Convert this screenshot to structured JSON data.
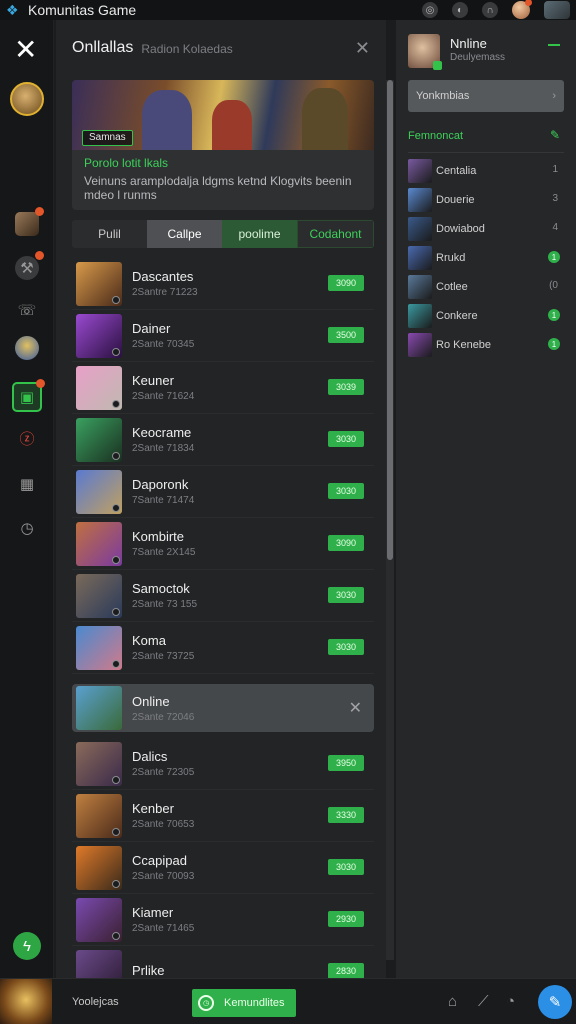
{
  "app": {
    "title": "Komunitas Game"
  },
  "rail": {
    "active_badge": ""
  },
  "panel": {
    "title": "Onllallas",
    "subtitle": "Radion Kolaedas",
    "hero": {
      "tag": "Samnas",
      "heading": "Porolo lotit lkals",
      "description": "Veinuns aramplodalja ldgms ketnd Klogvits beenin mdeo l runms"
    },
    "tabs": [
      "Pulil",
      "Callpe",
      "poolime",
      "Codahont"
    ]
  },
  "games": [
    {
      "name": "Dascantes",
      "meta": "2Santre 71223",
      "btn": "3090",
      "colors": [
        "#d89a4a",
        "#4a2a1a"
      ]
    },
    {
      "name": "Dainer",
      "meta": "2Sante 70345",
      "btn": "3500",
      "colors": [
        "#9a4ad0",
        "#2a1040"
      ]
    },
    {
      "name": "Keuner",
      "meta": "2Sante 71624",
      "btn": "3039",
      "colors": [
        "#e8a0c8",
        "#c0b8b0"
      ]
    },
    {
      "name": "Keocrame",
      "meta": "2Sante 71834",
      "btn": "3030",
      "colors": [
        "#3aa060",
        "#1a3020"
      ]
    },
    {
      "name": "Daporonk",
      "meta": "7Sante 71474",
      "btn": "3030",
      "colors": [
        "#5a7ad0",
        "#c0a060"
      ]
    },
    {
      "name": "Kombirte",
      "meta": "7Sante 2X145",
      "btn": "3090",
      "colors": [
        "#c07040",
        "#7a3aa0"
      ]
    },
    {
      "name": "Samoctok",
      "meta": "2Sante 73 155",
      "btn": "3030",
      "colors": [
        "#7a6a5a",
        "#2a3a5a"
      ]
    },
    {
      "name": "Koma",
      "meta": "2Sante 73725",
      "btn": "3030",
      "colors": [
        "#4a8ad0",
        "#d07a8a"
      ]
    }
  ],
  "special_row": {
    "name": "Online",
    "meta": "2Sante 72046"
  },
  "games_more": [
    {
      "name": "Dalics",
      "meta": "2Sante 72305",
      "btn": "3950",
      "colors": [
        "#8a6a5a",
        "#3a2a4a"
      ]
    },
    {
      "name": "Kenber",
      "meta": "2Sante 70653",
      "btn": "3330",
      "colors": [
        "#c08040",
        "#4a2a1a"
      ]
    },
    {
      "name": "Ccapipad",
      "meta": "2Sante 70093",
      "btn": "3030",
      "colors": [
        "#e07a2a",
        "#3a2a1a"
      ]
    },
    {
      "name": "Kiamer",
      "meta": "2Sante 71465",
      "btn": "2930",
      "colors": [
        "#7a4ab0",
        "#3a2030"
      ]
    },
    {
      "name": "Prlike",
      "meta": "",
      "btn": "2830",
      "colors": [
        "#6a4a8a",
        "#2a1a30"
      ]
    }
  ],
  "right": {
    "name": "Nnline",
    "status": "Deulyemass",
    "search": "Yonkmbias",
    "section": "Femnoncat",
    "friends": [
      {
        "name": "Centalia",
        "count": "1",
        "dot": false,
        "color": "#7a5aa0"
      },
      {
        "name": "Douerie",
        "count": "3",
        "dot": false,
        "color": "#5a8ad0"
      },
      {
        "name": "Dowiabod",
        "count": "4",
        "dot": false,
        "color": "#3a5a8a"
      },
      {
        "name": "Rrukd",
        "count": "1",
        "dot": true,
        "color": "#4a6ab0"
      },
      {
        "name": "Cotlee",
        "count": "(0",
        "dot": false,
        "color": "#5a7a9a"
      },
      {
        "name": "Conkere",
        "count": "1",
        "dot": true,
        "color": "#3a9aa0"
      },
      {
        "name": "Ro Kenebe",
        "count": "1",
        "dot": true,
        "color": "#8a4ab0"
      }
    ]
  },
  "bottom": {
    "label": "Yoolejcas",
    "button": "Kemundlites"
  }
}
